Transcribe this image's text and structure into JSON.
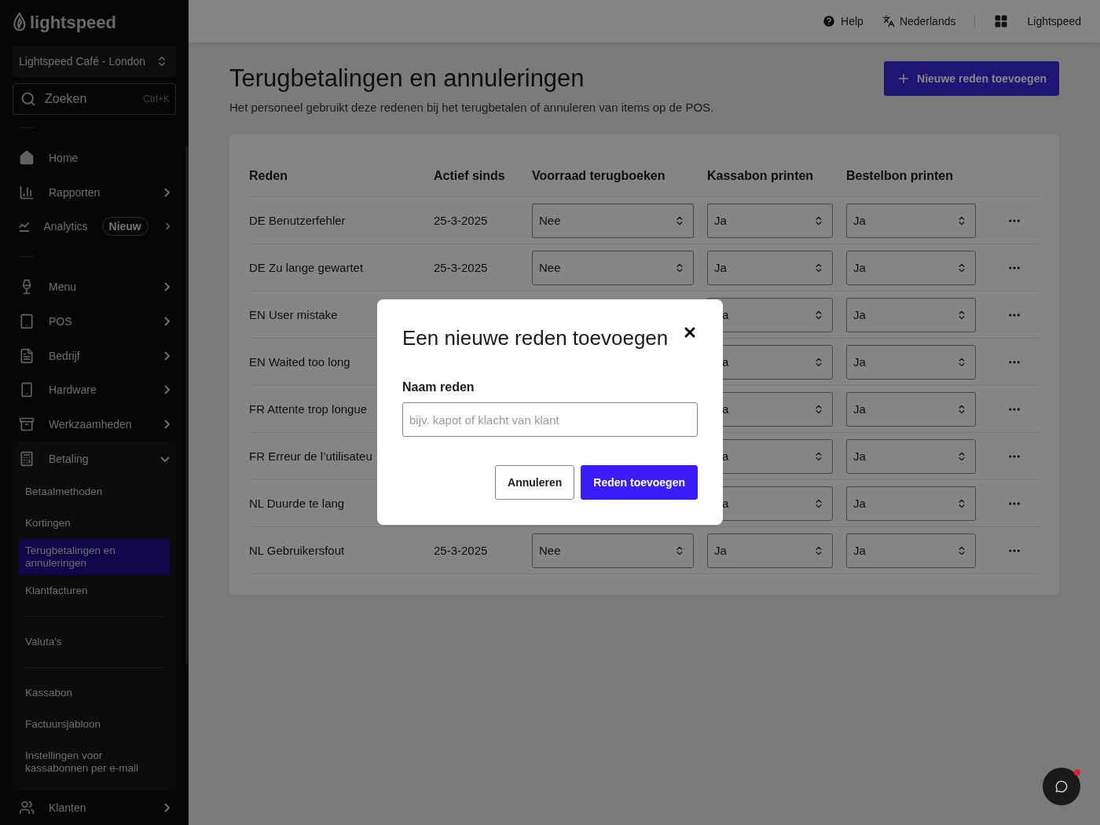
{
  "sidebar": {
    "logo": "lightspeed",
    "location": "Lightspeed Café - London",
    "search": {
      "placeholder": "Zoeken",
      "shortcut": "Ctrl+K"
    },
    "sections": [
      [
        {
          "label": "Home",
          "chevron": false
        },
        {
          "label": "Rapporten",
          "chevron": true
        },
        {
          "label": "Analytics",
          "badge": "Nieuw",
          "chevron": true
        }
      ],
      [
        {
          "label": "Menu",
          "chevron": true
        },
        {
          "label": "POS",
          "chevron": true
        },
        {
          "label": "Bedrijf",
          "chevron": true
        },
        {
          "label": "Hardware",
          "chevron": true
        },
        {
          "label": "Werkzaamheden",
          "chevron": true
        },
        {
          "label": "Betaling",
          "chevron": true,
          "expanded": true,
          "children": [
            {
              "kind": "link",
              "label": "Betaalmethoden",
              "selected": false
            },
            {
              "kind": "link",
              "label": "Kortingen",
              "selected": false
            },
            {
              "kind": "link",
              "label": "Terugbetalingen en annuleringen",
              "selected": true
            },
            {
              "kind": "link",
              "label": "Klantfacturen",
              "selected": false
            },
            {
              "kind": "divider"
            },
            {
              "kind": "link",
              "label": "Valuta's",
              "selected": false
            },
            {
              "kind": "divider"
            },
            {
              "kind": "link",
              "label": "Kassabon",
              "selected": false
            },
            {
              "kind": "link",
              "label": "Factuursjabloon",
              "selected": false
            },
            {
              "kind": "link",
              "label": "Instellingen voor kassabonnen per e-mail",
              "selected": false
            }
          ]
        },
        {
          "label": "Klanten",
          "chevron": true,
          "expanded": false
        }
      ]
    ]
  },
  "topbar": {
    "help": "Help",
    "language": "Nederlands",
    "account": "Lightspeed"
  },
  "page": {
    "title": "Terugbetalingen en annuleringen",
    "subtitle": "Het personeel gebruikt deze redenen bij het terugbetalen of annuleren van items op de POS.",
    "add_button": "Nieuwe reden toevoegen"
  },
  "table": {
    "columns": [
      "Reden",
      "Actief sinds",
      "Voorraad terugboeken",
      "Kassabon printen",
      "Bestelbon printen"
    ],
    "rows": [
      {
        "reason": "DE Benutzerfehler",
        "since": "25-3-2025",
        "stock": "Nee",
        "receipt": "Ja",
        "order": "Ja"
      },
      {
        "reason": "DE Zu lange gewartet",
        "since": "25-3-2025",
        "stock": "Nee",
        "receipt": "Ja",
        "order": "Ja"
      },
      {
        "reason": "EN User mistake",
        "receipt": "a",
        "receipt_cut": true,
        "order": "Ja"
      },
      {
        "reason": "EN Waited too long",
        "receipt": "a",
        "receipt_cut": true,
        "order": "Ja"
      },
      {
        "reason": "FR Attente trop longue",
        "receipt": "a",
        "receipt_cut": true,
        "order": "Ja"
      },
      {
        "reason": "FR Erreur de l’utilisateu",
        "receipt": "a",
        "receipt_cut": true,
        "order": "Ja"
      },
      {
        "reason": "NL Duurde te lang",
        "receipt": "a",
        "receipt_cut": true,
        "order": "Ja"
      },
      {
        "reason": "NL Gebruikersfout",
        "since": "25-3-2025",
        "stock": "Nee",
        "receipt": "Ja",
        "order": "Ja"
      }
    ]
  },
  "dialog": {
    "title": "Een nieuwe reden toevoegen",
    "field_label": "Naam reden",
    "placeholder": "bijv. kapot of klacht van klant",
    "cancel": "Annuleren",
    "confirm": "Reden toevoegen"
  },
  "chat": {
    "unread": true
  }
}
